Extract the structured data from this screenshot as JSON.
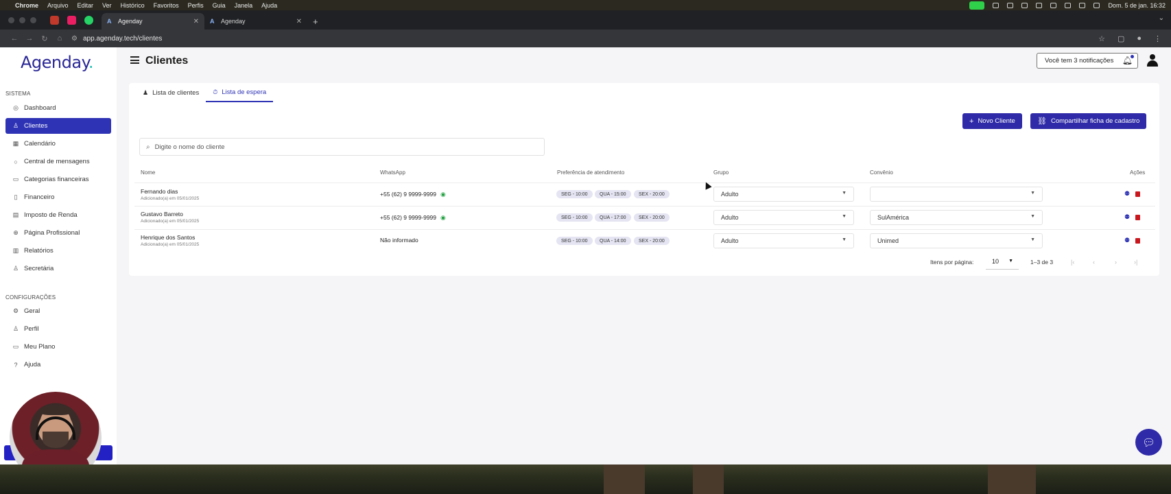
{
  "menubar": {
    "app": "Chrome",
    "items": [
      "Arquivo",
      "Editar",
      "Ver",
      "Histórico",
      "Favoritos",
      "Perfis",
      "Guia",
      "Janela",
      "Ajuda"
    ],
    "clock": "Dom. 5 de jan.  16:32"
  },
  "browser": {
    "tabs": [
      {
        "label": "Agenday",
        "active": true
      },
      {
        "label": "Agenday",
        "active": false
      }
    ],
    "url": "app.agenday.tech/clientes"
  },
  "sidebar": {
    "logo_text": "Agenday",
    "logo_dot": ".",
    "section_sistema": "SISTEMA",
    "items_sistema": [
      {
        "label": "Dashboard",
        "icon": "dashboard-icon",
        "active": false
      },
      {
        "label": "Clientes",
        "icon": "users-icon",
        "active": true
      },
      {
        "label": "Calendário",
        "icon": "calendar-icon",
        "active": false
      },
      {
        "label": "Central de mensagens",
        "icon": "chat-icon",
        "active": false
      },
      {
        "label": "Categorias financeiras",
        "icon": "folder-icon",
        "active": false
      },
      {
        "label": "Financeiro",
        "icon": "dollar-icon",
        "active": false
      },
      {
        "label": "Imposto de Renda",
        "icon": "document-icon",
        "active": false
      },
      {
        "label": "Página Profissional",
        "icon": "globe-icon",
        "active": false
      },
      {
        "label": "Relatórios",
        "icon": "report-icon",
        "active": false
      },
      {
        "label": "Secretária",
        "icon": "person-icon",
        "active": false
      }
    ],
    "section_config": "CONFIGURAÇÕES",
    "items_config": [
      {
        "label": "Geral",
        "icon": "gear-icon"
      },
      {
        "label": "Perfil",
        "icon": "person-icon"
      },
      {
        "label": "Meu Plano",
        "icon": "card-icon"
      },
      {
        "label": "Ajuda",
        "icon": "help-icon"
      }
    ]
  },
  "header": {
    "title": "Clientes",
    "notifications": "Você tem 3 notificações"
  },
  "tabs": [
    {
      "label": "Lista de clientes",
      "active": false
    },
    {
      "label": "Lista de espera",
      "active": true
    }
  ],
  "actions": {
    "new_client": "Novo Cliente",
    "share_form": "Compartilhar ficha de cadastro"
  },
  "search": {
    "placeholder": "Digite o nome do cliente"
  },
  "table": {
    "columns": [
      "Nome",
      "WhatsApp",
      "Preferência de atendimento",
      "Grupo",
      "Convênio",
      "Ações"
    ],
    "rows": [
      {
        "name": "Fernando dias",
        "added": "Adicionado(a) em 05/01/2025",
        "whatsapp": "+55 (62) 9 9999-9999",
        "prefs": [
          "SEG - 10:00",
          "QUA - 15:00",
          "SEX - 20:00"
        ],
        "group": "Adulto",
        "insurance": ""
      },
      {
        "name": "Gustavo Barreto",
        "added": "Adicionado(a) em 05/01/2025",
        "whatsapp": "+55 (62) 9 9999-9999",
        "prefs": [
          "SEG - 10:00",
          "QUA - 17:00",
          "SEX - 20:00"
        ],
        "group": "Adulto",
        "insurance": "SulAmérica"
      },
      {
        "name": "Henrique dos Santos",
        "added": "Adicionado(a) em 05/01/2025",
        "whatsapp": "Não informado",
        "prefs": [
          "SEG - 10:00",
          "QUA - 14:00",
          "SEX - 20:00"
        ],
        "group": "Adulto",
        "insurance": "Unimed"
      }
    ]
  },
  "pagination": {
    "items_per_page_label": "Itens por página:",
    "items_per_page": "10",
    "range": "1–3 de 3"
  },
  "colors": {
    "primary": "#2e2aa8",
    "active_sidebar": "#2e33b5",
    "delete": "#c9171e",
    "whatsapp": "#25a244"
  }
}
